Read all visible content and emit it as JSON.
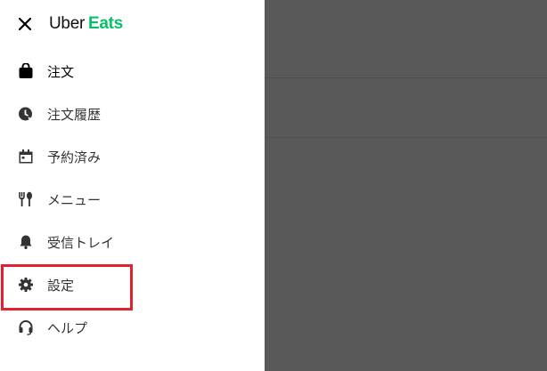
{
  "header": {
    "close_icon": "close-icon",
    "brand_part1": "Uber",
    "brand_part2": "Eats",
    "brand_color": "#06c167"
  },
  "menu": {
    "items": [
      {
        "label": "注文",
        "icon": "bag-icon",
        "active": true
      },
      {
        "label": "注文履歴",
        "icon": "history-icon"
      },
      {
        "label": "予約済み",
        "icon": "calendar-icon"
      },
      {
        "label": "メニュー",
        "icon": "utensils-icon"
      },
      {
        "label": "受信トレイ",
        "icon": "bell-icon"
      },
      {
        "label": "設定",
        "icon": "gear-icon",
        "highlighted": true
      },
      {
        "label": "ヘルプ",
        "icon": "headset-icon"
      }
    ]
  },
  "highlight_color": "#e4202e"
}
